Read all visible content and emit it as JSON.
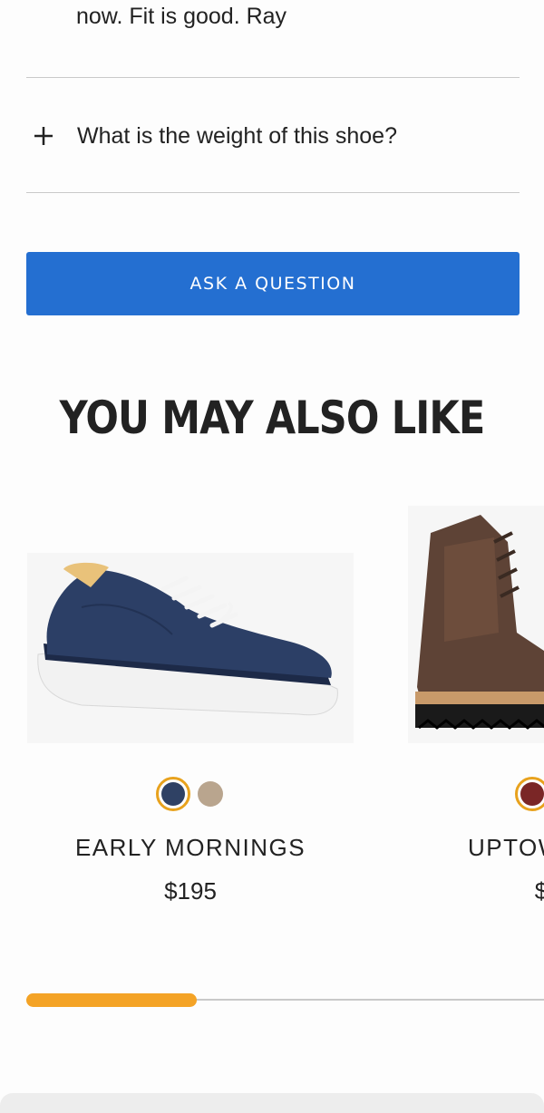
{
  "review": {
    "tail_text": "now. Fit is good. Ray"
  },
  "faq": {
    "question": "What is the weight of this shoe?",
    "icon": "plus-icon"
  },
  "ask_button": {
    "label": "ASK A QUESTION",
    "color": "#246fd1"
  },
  "recommendations": {
    "title": "YOU MAY ALSO LIKE",
    "products": [
      {
        "name": "EARLY MORNINGS",
        "price": "$195",
        "swatches": [
          {
            "color": "#2f4164",
            "selected": true
          },
          {
            "color": "#b9a58e",
            "selected": false
          }
        ]
      },
      {
        "name": "UPTOWN",
        "price": "$",
        "swatches": [
          {
            "color": "#7a2626",
            "selected": true
          }
        ]
      }
    ]
  },
  "carousel_progress": {
    "fraction": 0.33,
    "color": "#f4a326"
  }
}
